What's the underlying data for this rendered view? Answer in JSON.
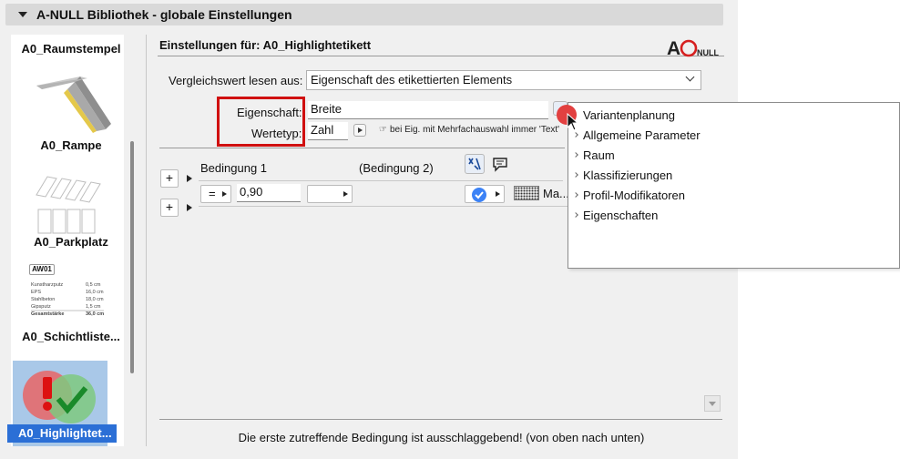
{
  "title": "A-NULL Bibliothek - globale Einstellungen",
  "sidebar": {
    "items": [
      {
        "label": "A0_Raumstempel"
      },
      {
        "label": "A0_Rampe"
      },
      {
        "label": "A0_Parkplatz"
      },
      {
        "label": "A0_Schichtliste..."
      },
      {
        "label": "A0_Highlightet...",
        "selected": true
      }
    ],
    "layer_table": {
      "tag": "AW01",
      "rows": [
        [
          "Kunstharzputz",
          "0,5 cm"
        ],
        [
          "EPS",
          "16,0 cm"
        ],
        [
          "Stahlbeton",
          "18,0 cm"
        ],
        [
          "Gipsputz",
          "1,5 cm"
        ],
        [
          "Gesamtstärke",
          "36,0 cm"
        ]
      ]
    }
  },
  "main": {
    "heading": "Einstellungen für: A0_Highlightetikett",
    "logo_text": "A0NULL",
    "compare_label": "Vergleichswert lesen aus:",
    "compare_value": "Eigenschaft des etikettierten Elements",
    "property_label": "Eigenschaft:",
    "property_value": "Breite",
    "valuetype_label": "Wertetyp:",
    "valuetype_value": "Zahl",
    "hint": "bei Eig. mit Mehrfachauswahl immer 'Text' e",
    "condition1": "Bedingung 1",
    "condition2": "(Bedingung 2)",
    "operator": "=",
    "cond_value": "0,90",
    "material_label": "Ma...",
    "plus": "+",
    "footer": "Die erste zutreffende Bedingung ist ausschlaggebend! (von oben nach unten)"
  },
  "menu": {
    "items": [
      {
        "label": "Variantenplanung",
        "has_arrow": false
      },
      {
        "label": "Allgemeine Parameter",
        "has_arrow": true
      },
      {
        "label": "Raum",
        "has_arrow": true
      },
      {
        "label": "Klassifizierungen",
        "has_arrow": true
      },
      {
        "label": "Profil-Modifikatoren",
        "has_arrow": true
      },
      {
        "label": "Eigenschaften",
        "has_arrow": true
      }
    ]
  },
  "colors": {
    "accent": "#2b6fd6",
    "highlight_box": "#d01010",
    "logo_red": "#d62020"
  }
}
